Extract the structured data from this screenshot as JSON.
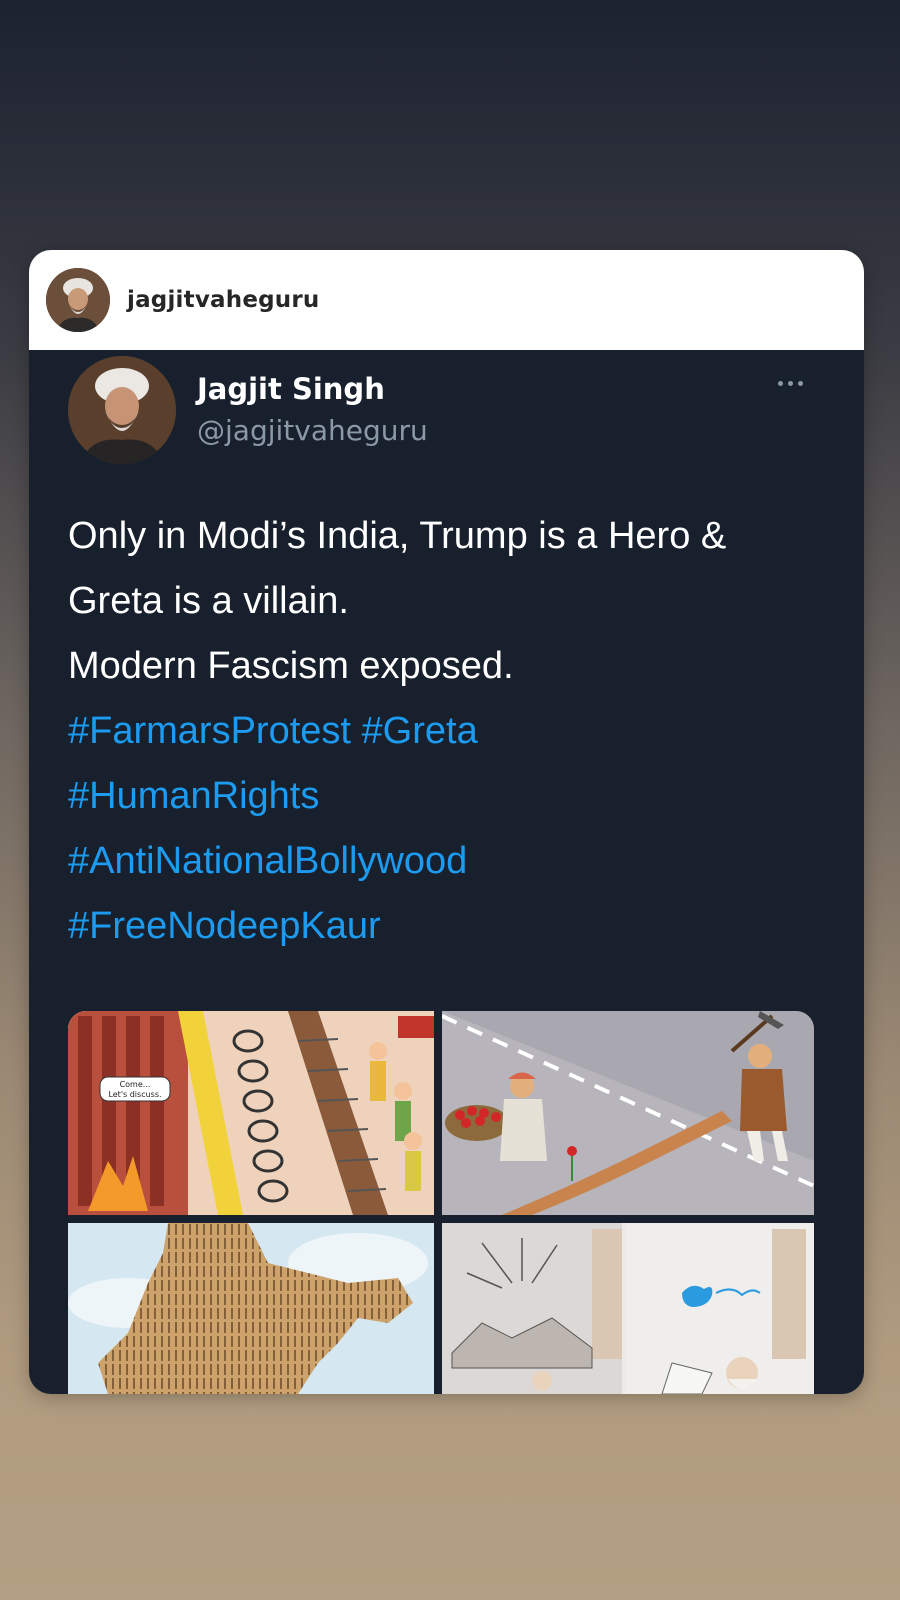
{
  "story_header": {
    "username": "jagjitvaheguru"
  },
  "tweet": {
    "display_name": "Jagjit Singh",
    "handle": "@jagjitvaheguru",
    "text_lines": [
      "Only in Modi’s India, Trump is a Hero &",
      "Greta is a villain.",
      "Modern Fascism exposed."
    ],
    "hashtag_lines": [
      [
        "#FarmarsProtest",
        "#Greta"
      ],
      [
        "#HumanRights"
      ],
      [
        "#AntiNationalBollywood"
      ],
      [
        "#FreeNodeepKaur"
      ]
    ],
    "more_icon": "more-horizontal-icon"
  },
  "media": {
    "images": [
      {
        "name": "cartoon-barricade-farmers",
        "caption_text": [
          "Come...",
          "Let's discuss."
        ]
      },
      {
        "name": "cartoon-road-crack-farmer"
      },
      {
        "name": "cartoon-india-map-nails"
      },
      {
        "name": "cartoon-twitter-bird-window"
      }
    ]
  },
  "colors": {
    "card_bg": "#17202c",
    "header_bg": "#ffffff",
    "text_primary": "#ffffff",
    "text_secondary": "#8b98a5",
    "hashtag": "#1d9bf0"
  }
}
